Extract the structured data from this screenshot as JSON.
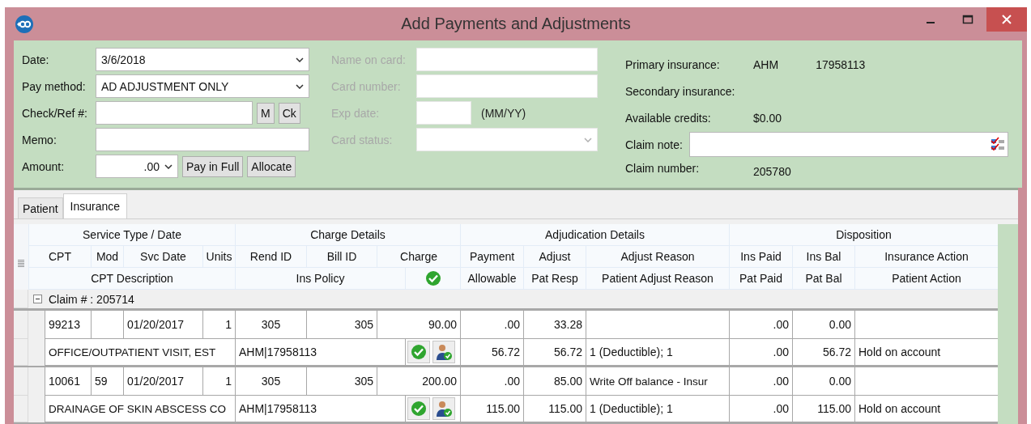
{
  "window": {
    "title": "Add Payments and Adjustments"
  },
  "form": {
    "left": [
      {
        "label": "Date:",
        "kind": "dropdown",
        "value": "3/6/2018"
      },
      {
        "label": "Pay method:",
        "kind": "dropdown",
        "value": "AD  ADJUSTMENT ONLY"
      },
      {
        "label": "Check/Ref #:",
        "kind": "text_buttons",
        "buttons": [
          "M",
          "Ck"
        ]
      },
      {
        "label": "Memo:",
        "kind": "text"
      },
      {
        "label": "Amount:",
        "kind": "amount",
        "value": ".00",
        "buttons": [
          "Pay in Full",
          "Allocate"
        ]
      }
    ],
    "card": [
      {
        "label": "Name on card:",
        "kind": "text",
        "disabled": true
      },
      {
        "label": "Card number:",
        "kind": "text",
        "disabled": true
      },
      {
        "label": "Exp date:",
        "kind": "short",
        "disabled": true,
        "hint": "(MM/YY)"
      },
      {
        "label": "Card status:",
        "kind": "dropdown",
        "disabled": true
      }
    ],
    "info": [
      {
        "label": "Primary insurance:",
        "kind": "text",
        "values": [
          "AHM",
          "17958113"
        ]
      },
      {
        "label": "Secondary insurance:",
        "kind": "text"
      },
      {
        "label": "Available credits:",
        "kind": "text",
        "values": [
          "$0.00"
        ]
      },
      {
        "label": "Claim note:",
        "kind": "note_field"
      },
      {
        "label": "Claim number:",
        "kind": "text",
        "values": [
          "205780"
        ]
      }
    ]
  },
  "tabs": [
    {
      "label": "Patient",
      "selected": false
    },
    {
      "label": "Insurance",
      "selected": true
    }
  ],
  "table": {
    "groups": [
      "Service Type / Date",
      "Charge Details",
      "Adjudication Details",
      "Disposition"
    ],
    "columns": [
      "CPT",
      "Mod",
      "Svc Date",
      "Units",
      "Rend ID",
      "Bill ID",
      "Charge",
      "Payment",
      "Adjust",
      "Adjust Reason",
      "Ins Paid",
      "Ins Bal",
      "Insurance Action"
    ],
    "sub_columns": [
      "CPT Description",
      "Ins Policy",
      "Allowable",
      "Pat Resp",
      "Patient Adjust Reason",
      "Pat Paid",
      "Pat Bal",
      "Patient Action"
    ],
    "claims": [
      {
        "label": "Claim # : 205714",
        "expanded": true,
        "lines": [
          {
            "main": {
              "cpt": "99213",
              "svc_date": "01/20/2017",
              "units": "1",
              "rend_id": "305",
              "bill_id": "305",
              "charge": "90.00",
              "payment": ".00",
              "adjust": "33.28",
              "ins_paid": ".00",
              "ins_bal": "0.00"
            },
            "sub": [
              "OFFICE/OUTPATIENT VISIT, EST",
              "AHM|17958113",
              "56.72",
              "56.72",
              "1 (Deductible); 1",
              ".00",
              "56.72",
              "Hold on account"
            ]
          },
          {
            "main": {
              "cpt": "10061",
              "mod": "59",
              "svc_date": "01/20/2017",
              "units": "1",
              "rend_id": "305",
              "bill_id": "305",
              "charge": "200.00",
              "payment": ".00",
              "adjust": "85.00",
              "adjust_reason": "Write Off balance - Insur",
              "ins_paid": ".00",
              "ins_bal": "0.00"
            },
            "sub": [
              "DRAINAGE OF SKIN ABSCESS CO",
              "AHM|17958113",
              "115.00",
              "115.00",
              "1 (Deductible); 1",
              ".00",
              "115.00",
              "Hold on account"
            ]
          }
        ]
      }
    ]
  }
}
